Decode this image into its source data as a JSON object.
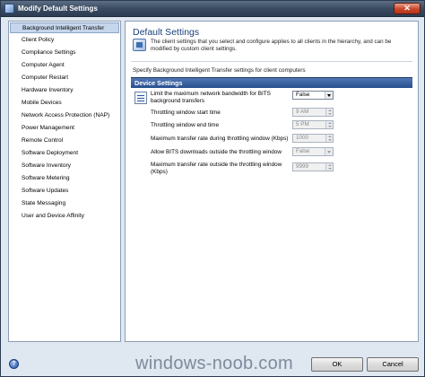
{
  "window": {
    "title": "Modify Default Settings",
    "close_glyph": "✕"
  },
  "sidebar": {
    "items": [
      {
        "label": "Background Intelligent Transfer",
        "selected": true
      },
      {
        "label": "Client Policy"
      },
      {
        "label": "Compliance Settings"
      },
      {
        "label": "Computer Agent"
      },
      {
        "label": "Computer Restart"
      },
      {
        "label": "Hardware Inventory"
      },
      {
        "label": "Mobile Devices"
      },
      {
        "label": "Network Access Protection (NAP)"
      },
      {
        "label": "Power Management"
      },
      {
        "label": "Remote Control"
      },
      {
        "label": "Software Deployment"
      },
      {
        "label": "Software Inventory"
      },
      {
        "label": "Software Metering"
      },
      {
        "label": "Software Updates"
      },
      {
        "label": "State Messaging"
      },
      {
        "label": "User and Device Affinity"
      }
    ]
  },
  "main": {
    "title": "Default Settings",
    "description": "The client settings that you select and configure applies to all clients in the hierarchy, and can be modified by custom client settings.",
    "subdescription": "Specify Background Intelligent Transfer settings for client computers",
    "section_title": "Device Settings",
    "settings": [
      {
        "label": "Limit the maximum network bandwidth for BITS background transfers",
        "value": "False",
        "kind": "dropdown",
        "enabled": true
      },
      {
        "label": "Throttling window start time",
        "value": "9 AM",
        "kind": "spinner",
        "enabled": false
      },
      {
        "label": "Throttling window end time",
        "value": "5 PM",
        "kind": "spinner",
        "enabled": false
      },
      {
        "label": "Maximum transfer rate during throttling window (Kbps)",
        "value": "1000",
        "kind": "spinner",
        "enabled": false
      },
      {
        "label": "Allow BITS downloads outside the throttling window",
        "value": "False",
        "kind": "dropdown",
        "enabled": false
      },
      {
        "label": "Maximum transfer rate outside the throttling window (Kbps)",
        "value": "9999",
        "kind": "spinner",
        "enabled": false
      }
    ]
  },
  "footer": {
    "help_glyph": "?",
    "watermark": "windows-noob.com",
    "ok_label": "OK",
    "cancel_label": "Cancel"
  },
  "colors": {
    "title_blue": "#1b3f7a",
    "section_bar": "#264f8f",
    "selected_item": "#c6d6ec"
  },
  "icons": [
    "app-icon",
    "close-icon",
    "settings-header-icon",
    "device-settings-icon",
    "help-icon"
  ]
}
